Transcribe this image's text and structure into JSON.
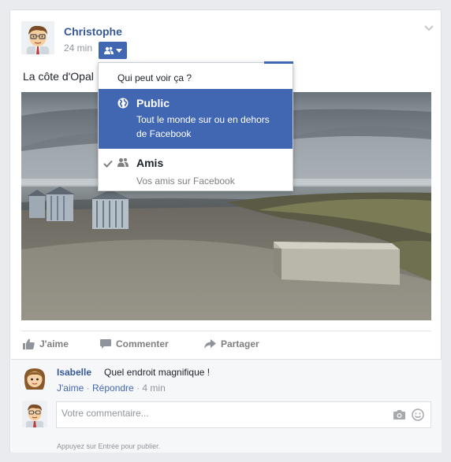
{
  "post": {
    "author": "Christophe",
    "time": "24 min",
    "text": "La côte d'Opal",
    "audience_icon": "friends-icon"
  },
  "audience_menu": {
    "header": "Qui peut voir ça ?",
    "options": [
      {
        "title": "Public",
        "description": "Tout le monde sur ou en dehors de Facebook",
        "icon": "globe-icon",
        "highlighted": true
      },
      {
        "title": "Amis",
        "description": "Vos amis sur Facebook",
        "icon": "friends-icon",
        "selected": true
      }
    ]
  },
  "actions": {
    "like": "J'aime",
    "comment": "Commenter",
    "share": "Partager"
  },
  "comment": {
    "author": "Isabelle",
    "text": "Quel endroit magnifique !",
    "like": "J'aime",
    "separator": "·",
    "reply": "Répondre",
    "time": "4 min"
  },
  "composer": {
    "placeholder": "Votre commentaire...",
    "hint": "Appuyez sur Entrée pour publier."
  },
  "colors": {
    "link": "#365899",
    "accent": "#4267b2",
    "muted": "#90949c"
  }
}
